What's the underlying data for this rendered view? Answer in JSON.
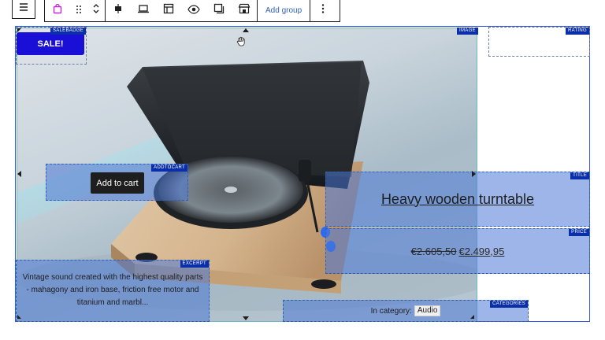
{
  "toolbar": {
    "document_overview_icon": "list-view-icon",
    "buttons": [
      {
        "name": "block-type-icon",
        "icon": "product-bag"
      },
      {
        "name": "drag-handle-icon",
        "icon": "drag"
      },
      {
        "name": "move-updown-icon",
        "icon": "chevrons"
      },
      {
        "name": "align-icon",
        "icon": "justify-center"
      },
      {
        "name": "width-icon",
        "icon": "laptop"
      },
      {
        "name": "layout-icon",
        "icon": "layout"
      },
      {
        "name": "visibility-icon",
        "icon": "eye"
      },
      {
        "name": "copy-icon",
        "icon": "duplicate"
      },
      {
        "name": "store-icon",
        "icon": "storefront"
      }
    ],
    "add_group_label": "Add group",
    "more_icon": "more-vertical-icon"
  },
  "blocks": {
    "salebadge": {
      "tag": "SALEBADGE",
      "label": "SALE!"
    },
    "image": {
      "tag": "IMAGE"
    },
    "rating": {
      "tag": "RATING"
    },
    "addtocart": {
      "tag": "ADDTOCART",
      "label": "Add to cart"
    },
    "title": {
      "tag": "TITLE",
      "text": "Heavy wooden turntable"
    },
    "price": {
      "tag": "PRICE",
      "old": "€2.605,50",
      "new": "€2.499,95"
    },
    "excerpt": {
      "tag": "EXCERPT",
      "text": "Vintage sound created with the highest quality parts - mahagony and iron base, friction free motor and titanium and marbl..."
    },
    "categories": {
      "tag": "CATEGORIES",
      "prefix": "In category:",
      "value": "Audio"
    }
  },
  "colors": {
    "accent": "#3858e9",
    "selection": "#4c78d6",
    "tag_bg": "#0b2fa8",
    "sale_bg": "#1a0fd6",
    "button_dark": "#1e1e1e"
  }
}
